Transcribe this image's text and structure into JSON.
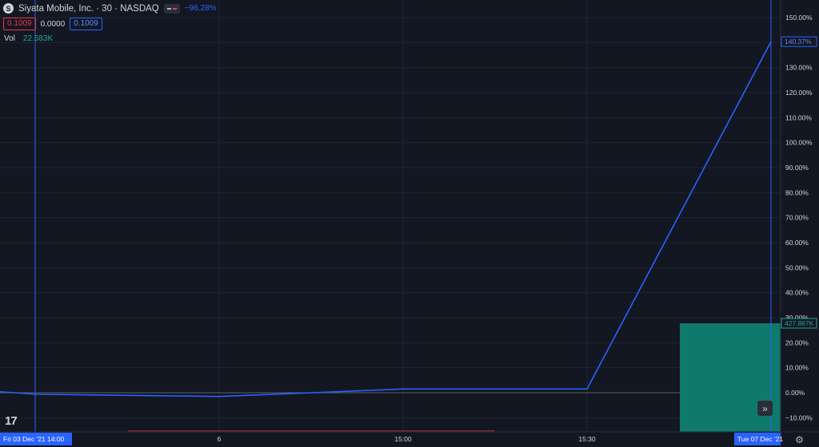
{
  "legend": {
    "title": "Siyata Mobile, Inc. · 30 · NASDAQ",
    "change": "−96.28%",
    "price_red": "0.1009",
    "price_mid": "0.0000",
    "price_blue": "0.1009",
    "vol_label": "Vol",
    "vol_value": "22.583K"
  },
  "colors": {
    "background": "#131722",
    "line": "#2962ff",
    "volume": "#0e7a6c",
    "grid": "#1f2330"
  },
  "icons": {
    "logo": "siyata-logo-icon",
    "brand": "tradingview-logo-icon",
    "scroll": "scroll-to-realtime-icon",
    "settings": "gear-icon"
  },
  "chart_data": {
    "type": "line",
    "title": "",
    "xlabel": "",
    "ylabel": "",
    "y_unit": "%",
    "ylim": [
      -15,
      150
    ],
    "y_ticks": [
      "150.00%",
      "140.00%",
      "130.00%",
      "120.00%",
      "110.00%",
      "100.00%",
      "90.00%",
      "80.00%",
      "70.00%",
      "60.00%",
      "50.00%",
      "40.00%",
      "30.00%",
      "20.00%",
      "10.00%",
      "0.00%",
      "−10.00%"
    ],
    "x_tick_labels": [
      "6",
      "15:00",
      "15:30"
    ],
    "crosshair_left_label": "Fri 03 Dec '21   14:00",
    "crosshair_right_label": "Tue 07 Dec '21",
    "series": [
      {
        "values": [
          0.4,
          -0.6,
          -1.5,
          0.0,
          1.5,
          1.5,
          140.37
        ]
      }
    ],
    "last_value_label": "140.37%",
    "volume_label": "427.867K",
    "grid": true
  }
}
